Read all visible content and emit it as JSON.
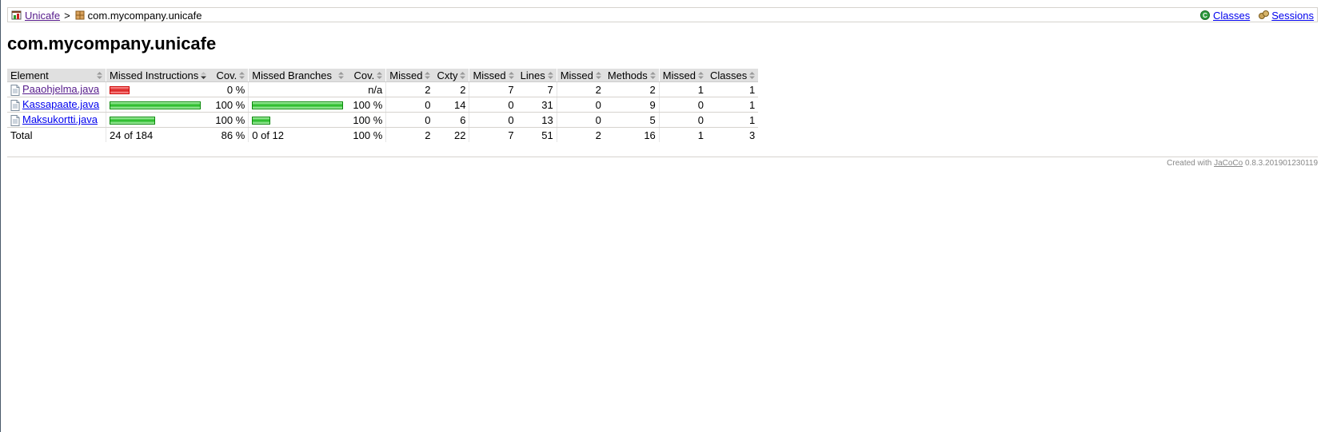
{
  "breadcrumb": {
    "root_label": "Unicafe",
    "separator": ">",
    "current_label": "com.mycompany.unicafe",
    "classes_label": "Classes",
    "sessions_label": "Sessions"
  },
  "page_title": "com.mycompany.unicafe",
  "table": {
    "headers": [
      "Element",
      "Missed Instructions",
      "Cov.",
      "Missed Branches",
      "Cov.",
      "Missed",
      "Cxty",
      "Missed",
      "Lines",
      "Missed",
      "Methods",
      "Missed",
      "Classes"
    ],
    "rows": [
      {
        "element": "Paaohjelma.java",
        "instr_missed_fraction": 1.0,
        "instr_covered_fraction": 0.0,
        "instr_cov": "0 %",
        "branch_missed_fraction": 0.0,
        "branch_covered_fraction": 0.0,
        "branch_cov": "n/a",
        "cxty_missed": "2",
        "cxty": "2",
        "lines_missed": "7",
        "lines": "7",
        "methods_missed": "2",
        "methods": "2",
        "classes_missed": "1",
        "classes": "1"
      },
      {
        "element": "Kassapaate.java",
        "instr_missed_fraction": 0.0,
        "instr_covered_fraction": 1.0,
        "instr_cov": "100 %",
        "branch_missed_fraction": 0.0,
        "branch_covered_fraction": 1.0,
        "branch_cov": "100 %",
        "cxty_missed": "0",
        "cxty": "14",
        "lines_missed": "0",
        "lines": "31",
        "methods_missed": "0",
        "methods": "9",
        "classes_missed": "0",
        "classes": "1"
      },
      {
        "element": "Maksukortti.java",
        "instr_missed_fraction": 0.0,
        "instr_covered_fraction": 0.5,
        "instr_cov": "100 %",
        "branch_missed_fraction": 0.0,
        "branch_covered_fraction": 0.2,
        "branch_cov": "100 %",
        "cxty_missed": "0",
        "cxty": "6",
        "lines_missed": "0",
        "lines": "13",
        "methods_missed": "0",
        "methods": "5",
        "classes_missed": "0",
        "classes": "1"
      }
    ],
    "total": {
      "label": "Total",
      "instr": "24 of 184",
      "instr_cov": "86 %",
      "branch": "0 of 12",
      "branch_cov": "100 %",
      "cxty_missed": "2",
      "cxty": "22",
      "lines_missed": "7",
      "lines": "51",
      "methods_missed": "2",
      "methods": "16",
      "classes_missed": "1",
      "classes": "3"
    }
  },
  "footer": {
    "prefix": "Created with",
    "tool_link": "JaCoCo",
    "version": "0.8.3.201901230119"
  },
  "colors": {
    "missed_bar": "#d81c1c",
    "covered_bar": "#1fb71f",
    "header_bg": "#e0e0e0"
  },
  "icons": {
    "report": "report-icon",
    "package": "package-icon",
    "classes": "classes-icon",
    "sessions": "sessions-icon",
    "source_file": "source-file-icon",
    "sort": "sort-icon"
  }
}
